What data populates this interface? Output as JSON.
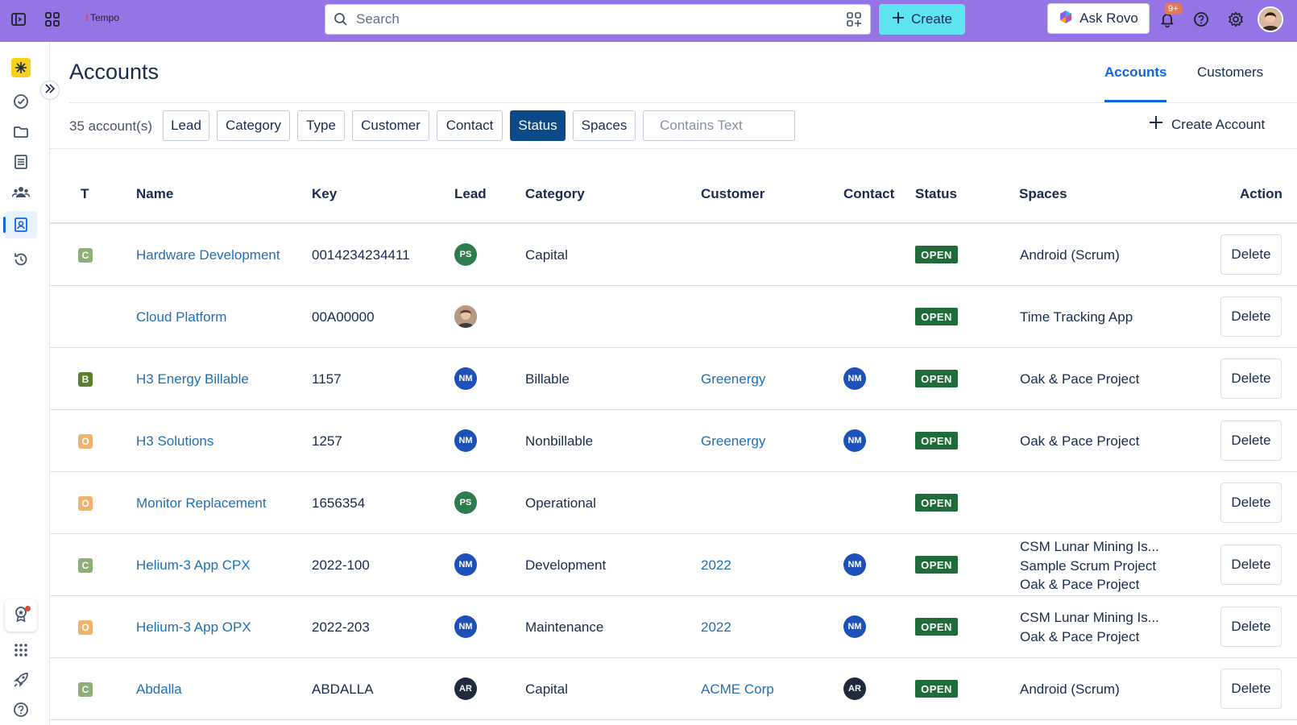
{
  "topbar": {
    "logo_text": "Tempo",
    "search_placeholder": "Search",
    "create_label": "Create",
    "rovo_label": "Ask Rovo",
    "notif_badge": "9+"
  },
  "page": {
    "title": "Accounts",
    "tabs": [
      "Accounts",
      "Customers"
    ],
    "active_tab": "Accounts"
  },
  "filters": {
    "count": "35 account(s)",
    "buttons": [
      "Lead",
      "Category",
      "Type",
      "Customer",
      "Contact",
      "Status",
      "Spaces"
    ],
    "active": "Status",
    "text_placeholder": "Contains Text",
    "create_account": "Create Account"
  },
  "table": {
    "headers": [
      "T",
      "Name",
      "Key",
      "Lead",
      "Category",
      "Customer",
      "Contact",
      "Status",
      "Spaces",
      "Action"
    ],
    "rows": [
      {
        "type": "C",
        "name": "Hardware Development",
        "key": "0014234234411",
        "lead": "PS",
        "category": "Capital",
        "customer": "",
        "contact": "",
        "status": "OPEN",
        "spaces": [
          "Android (Scrum)"
        ],
        "action": "Delete"
      },
      {
        "type": "",
        "name": "Cloud Platform",
        "key": "00A00000",
        "lead": "",
        "category": "",
        "customer": "",
        "contact": "",
        "status": "OPEN",
        "spaces": [
          "Time Tracking App"
        ],
        "action": "Delete"
      },
      {
        "type": "B",
        "name": "H3 Energy Billable",
        "key": "1157",
        "lead": "NM",
        "category": "Billable",
        "customer": "Greenergy",
        "contact": "NM",
        "status": "OPEN",
        "spaces": [
          "Oak & Pace Project"
        ],
        "action": "Delete"
      },
      {
        "type": "O",
        "name": "H3 Solutions",
        "key": "1257",
        "lead": "NM",
        "category": "Nonbillable",
        "customer": "Greenergy",
        "contact": "NM",
        "status": "OPEN",
        "spaces": [
          "Oak & Pace Project"
        ],
        "action": "Delete"
      },
      {
        "type": "O",
        "name": "Monitor Replacement",
        "key": "1656354",
        "lead": "PS",
        "category": "Operational",
        "customer": "",
        "contact": "",
        "status": "OPEN",
        "spaces": [],
        "action": "Delete"
      },
      {
        "type": "C",
        "name": "Helium-3 App CPX",
        "key": "2022-100",
        "lead": "NM",
        "category": "Development",
        "customer": "2022",
        "contact": "NM",
        "status": "OPEN",
        "spaces": [
          "CSM Lunar Mining Is...",
          "Sample Scrum Project",
          "Oak & Pace Project"
        ],
        "action": "Delete"
      },
      {
        "type": "O",
        "name": "Helium-3 App OPX",
        "key": "2022-203",
        "lead": "NM",
        "category": "Maintenance",
        "customer": "2022",
        "contact": "NM",
        "status": "OPEN",
        "spaces": [
          "CSM Lunar Mining Is...",
          "Oak & Pace Project"
        ],
        "action": "Delete"
      },
      {
        "type": "C",
        "name": "Abdalla",
        "key": "ABDALLA",
        "lead": "AR",
        "category": "Capital",
        "customer": "ACME Corp",
        "contact": "AR",
        "status": "OPEN",
        "spaces": [
          "Android (Scrum)"
        ],
        "action": "Delete"
      }
    ]
  },
  "colors": {
    "topbar": "#9575e6",
    "accent": "#0c66e4",
    "status_open": "#1f6b3a",
    "type_C": "#8fae78",
    "type_B": "#5a7d2e",
    "type_O": "#f0b36b",
    "av_PS": "#2e7d4f",
    "av_NM": "#1d50b8",
    "av_AR": "#1f2b3d"
  }
}
